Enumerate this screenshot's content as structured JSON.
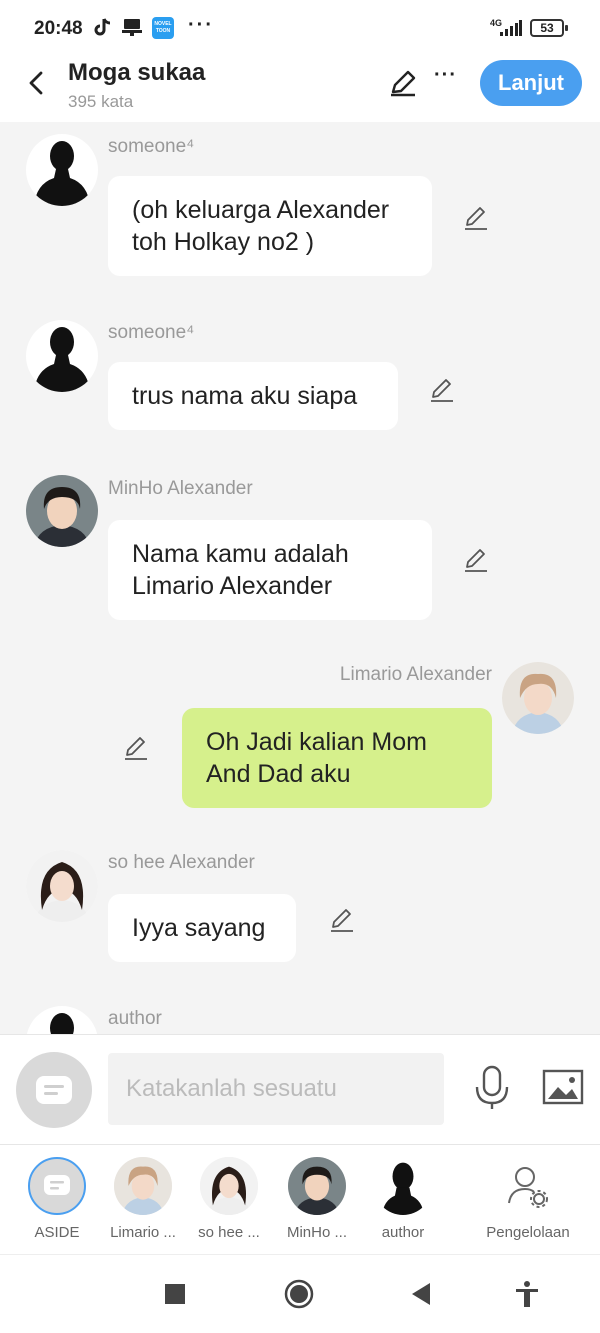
{
  "status_bar": {
    "time": "20:48",
    "network": "4G",
    "battery": "53"
  },
  "header": {
    "title": "Moga sukaa",
    "word_count": "395 kata",
    "next_label": "Lanjut"
  },
  "messages": [
    {
      "sender": "someone⁴",
      "text": "(oh keluarga Alexander toh Holkay no2 )",
      "mine": false,
      "avatar": "silhouette"
    },
    {
      "sender": "someone⁴",
      "text": "trus nama aku siapa",
      "mine": false,
      "avatar": "silhouette"
    },
    {
      "sender": "MinHo Alexander",
      "text": "Nama kamu adalah Limario Alexander",
      "mine": false,
      "avatar": "minho"
    },
    {
      "sender": "Limario Alexander",
      "text": "Oh Jadi kalian Mom And Dad aku",
      "mine": true,
      "avatar": "limario"
    },
    {
      "sender": "so hee Alexander",
      "text": "Iyya sayang",
      "mine": false,
      "avatar": "sohee"
    },
    {
      "sender": "author",
      "text": "",
      "mine": false,
      "avatar": "silhouette"
    }
  ],
  "input": {
    "placeholder": "Katakanlah sesuatu"
  },
  "characters": [
    {
      "label": "ASIDE",
      "kind": "aside"
    },
    {
      "label": "Limario ...",
      "kind": "limario"
    },
    {
      "label": "so hee ...",
      "kind": "sohee"
    },
    {
      "label": "MinHo ...",
      "kind": "minho"
    },
    {
      "label": "author",
      "kind": "silhouette"
    },
    {
      "label": "Pengelolaan",
      "kind": "manage"
    }
  ],
  "colors": {
    "accent": "#4a9ff0",
    "my_bubble": "#d6f08c",
    "background": "#f4f4f4"
  }
}
